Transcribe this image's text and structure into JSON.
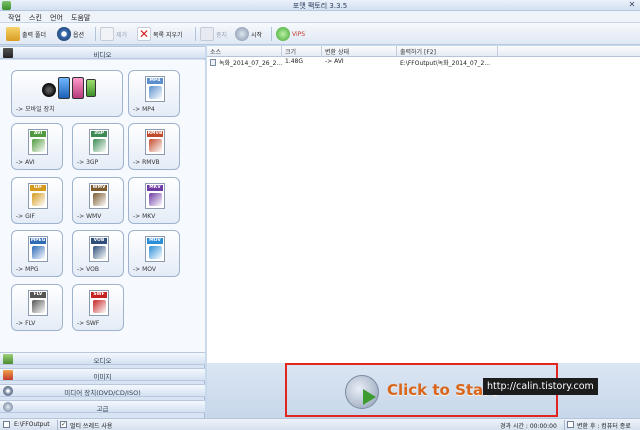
{
  "window": {
    "title": "포맷 팩토리 3.3.5"
  },
  "menu": [
    "작업",
    "스킨",
    "언어",
    "도움말"
  ],
  "toolbar": {
    "output_folder": "출력 폴더",
    "options": "옵션",
    "remove": "제거",
    "clear_list": "목록 지우기",
    "stop": "중지",
    "start": "시작",
    "vips": "ViPS"
  },
  "sidebar": {
    "video_category": "비디오",
    "audio_category": "오디오",
    "image_category": "이미지",
    "rom_category": "미디어 장치(DVD/CD/ISO)",
    "advanced_category": "고급",
    "formats": [
      {
        "caption": "-> 모바일 장치",
        "tag": "",
        "color": "#3b6fb6"
      },
      {
        "caption": "-> MP4",
        "tag": "MP4",
        "color": "#5b8fce"
      },
      {
        "caption": "-> AVI",
        "tag": "AVI",
        "color": "#4f9a3e"
      },
      {
        "caption": "-> 3GP",
        "tag": "3GP",
        "color": "#3d8a55"
      },
      {
        "caption": "-> RMVB",
        "tag": "RMVB",
        "color": "#c24a2c"
      },
      {
        "caption": "-> GIF",
        "tag": "GIF",
        "color": "#d39a1e"
      },
      {
        "caption": "-> WMV",
        "tag": "WMV",
        "color": "#7a5a2e"
      },
      {
        "caption": "-> MKV",
        "tag": "MKV",
        "color": "#6e3aa3"
      },
      {
        "caption": "-> MPG",
        "tag": "MPEG",
        "color": "#2e6ab6"
      },
      {
        "caption": "-> VOB",
        "tag": "VOB",
        "color": "#2f4f7a"
      },
      {
        "caption": "-> MOV",
        "tag": "MOV",
        "color": "#2b8fd8"
      },
      {
        "caption": "-> FLV",
        "tag": "FLV",
        "color": "#555555"
      },
      {
        "caption": "-> SWF",
        "tag": "SWF",
        "color": "#c62323"
      }
    ]
  },
  "file_list": {
    "columns": [
      "소스",
      "크기",
      "변환 상태",
      "출력하기 [F2]"
    ],
    "rows": [
      {
        "source": "녹화_2014_07_26_2...",
        "size": "1.48G",
        "status": "-> AVI",
        "output": "E:\\FFOutput\\녹화_2014_07_2..."
      }
    ]
  },
  "start_button": {
    "label": "Click to Start"
  },
  "watermark": "http://calin.tistory.com",
  "status": {
    "output_path": "E:\\FFOutput",
    "multithread": "멀티 쓰레드 사용",
    "elapsed": "경과 시간 : 00:00:00",
    "after": "변환 후 : 컴퓨터 종료"
  }
}
